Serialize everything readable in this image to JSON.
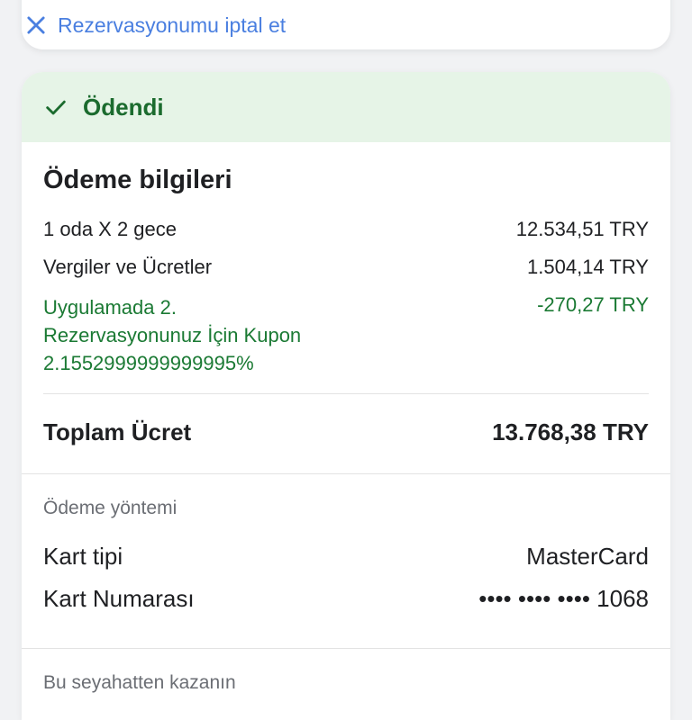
{
  "cancel": {
    "label": "Rezervasyonumu iptal et",
    "icon": "close-icon"
  },
  "status": {
    "label": "Ödendi",
    "icon": "check-icon",
    "color": "#1b6b2e",
    "bg": "#e6f4e7"
  },
  "payment": {
    "title": "Ödeme bilgileri",
    "rows": [
      {
        "label": "1 oda X 2 gece",
        "value": "12.534,51 TRY"
      },
      {
        "label": "Vergiler ve Ücretler",
        "value": "1.504,14 TRY"
      },
      {
        "label": "Uygulamada 2. Rezervasyonunuz İçin Kupon 2.1552999999999995%",
        "value": "-270,27 TRY"
      }
    ],
    "total": {
      "label": "Toplam Ücret",
      "value": "13.768,38 TRY"
    }
  },
  "method": {
    "title": "Ödeme yöntemi",
    "card_type": {
      "label": "Kart tipi",
      "value": "MasterCard"
    },
    "card_number": {
      "label": "Kart Numarası",
      "value": "•••• •••• •••• 1068"
    }
  },
  "earn": {
    "title": "Bu seyahatten kazanın"
  }
}
